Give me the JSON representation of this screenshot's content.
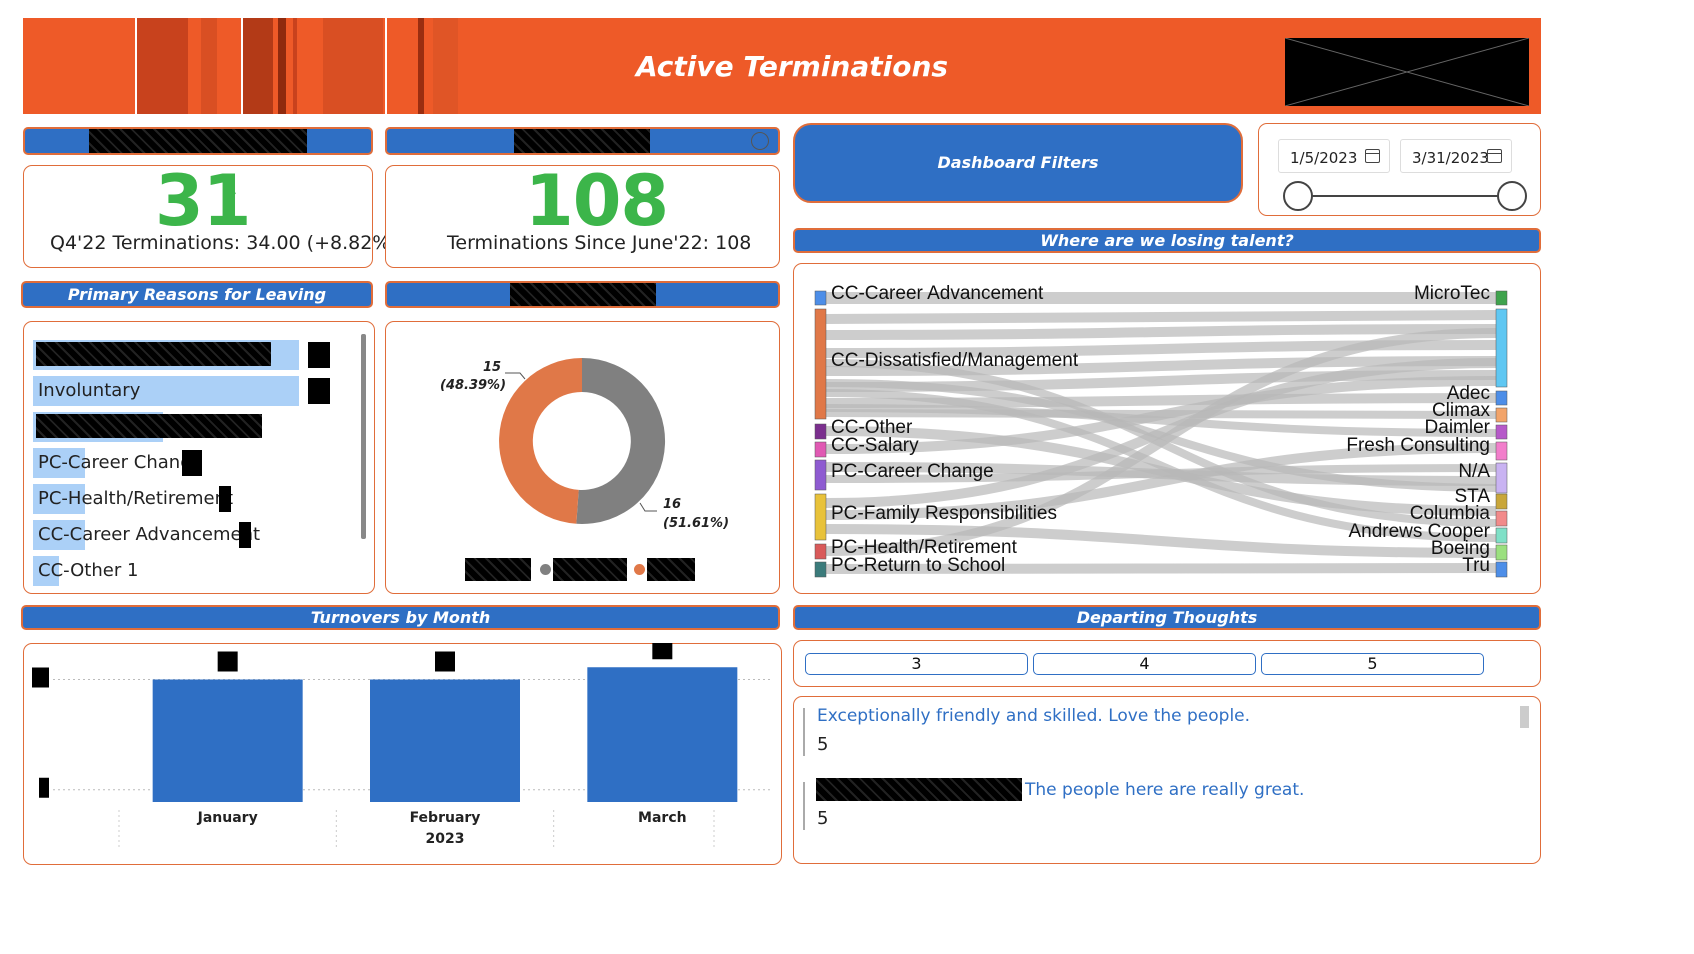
{
  "header": {
    "title": "Active Terminations"
  },
  "kpis": [
    {
      "value": "31",
      "check": "✓",
      "label": "Q4'22 Terminations: 34.00 (+8.82%)"
    },
    {
      "value": "108",
      "check": "✓",
      "label": "Terminations Since June'22: 108"
    }
  ],
  "sections": {
    "primary_reasons": "Primary Reasons for Leaving",
    "losing_talent": "Where are we losing talent?",
    "turnovers": "Turnovers by Month",
    "departing": "Departing Thoughts"
  },
  "filters": {
    "button_label": "Dashboard Filters",
    "start_date": "1/5/2023",
    "end_date": "3/31/2023",
    "icon": "calendar-icon"
  },
  "reasons": {
    "items": [
      {
        "label": "Involuntary",
        "bar": 0.74
      },
      {
        "label": "PC-Career Change",
        "bar": 0.15
      },
      {
        "label": "PC-Health/Retirement",
        "bar": 0.15
      },
      {
        "label": "CC-Career Advancement",
        "bar": 0.15
      },
      {
        "label": "CC-Other  1",
        "bar": 0.07
      }
    ]
  },
  "donut": {
    "slices": [
      {
        "value": 16,
        "label": "16",
        "pct": "(51.61%)",
        "color": "#808080"
      },
      {
        "value": 15,
        "label": "15",
        "pct": "(48.39%)",
        "color": "#e07848"
      }
    ]
  },
  "sankey": {
    "left": [
      "CC-Career Advancement",
      "CC-Dissatisfied/Management",
      "CC-Other",
      "CC-Salary",
      "PC-Career Change",
      "PC-Family Responsibilities",
      "PC-Health/Retirement",
      "PC-Return to School"
    ],
    "right": [
      "MicroTec",
      "Adec",
      "Climax",
      "Daimler",
      "Fresh Consulting",
      "N/A",
      "STA",
      "Columbia",
      "Andrews Cooper",
      "Boeing",
      "Tru"
    ]
  },
  "chart_data": {
    "type": "bar",
    "categories": [
      "January",
      "February",
      "March"
    ],
    "values": [
      10,
      10,
      11
    ],
    "xlabel": "2023",
    "ylim": [
      0,
      12
    ]
  },
  "departing": {
    "tabs": [
      "3",
      "4",
      "5"
    ],
    "comments": [
      {
        "text": "Exceptionally friendly and skilled. Love the people.",
        "rating": "5"
      },
      {
        "text": "The people here are really great.",
        "rating": "5"
      }
    ]
  }
}
